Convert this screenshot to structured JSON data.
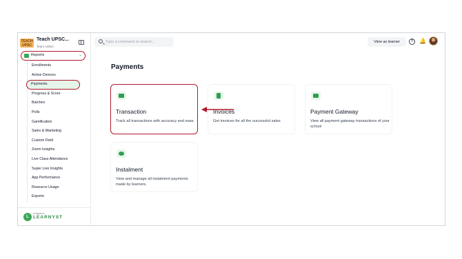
{
  "brand": {
    "name": "Teach UPSC...",
    "role": "Team Admin",
    "logo_text": "TEACH UPSC"
  },
  "sidebar": {
    "section_label": "Reports",
    "items": [
      {
        "label": "Enrollments"
      },
      {
        "label": "Active Devices"
      },
      {
        "label": "Payments",
        "active": true
      },
      {
        "label": "Progress & Score"
      },
      {
        "label": "Batches"
      },
      {
        "label": "Polls"
      },
      {
        "label": "Gamification"
      },
      {
        "label": "Sales & Marketing"
      },
      {
        "label": "Custom Field"
      },
      {
        "label": "Zoom Insights"
      },
      {
        "label": "Live Class Attendance"
      },
      {
        "label": "Super Live Insights"
      },
      {
        "label": "App Performance"
      },
      {
        "label": "Resource Usage"
      },
      {
        "label": "Exports"
      }
    ],
    "footer_powered": "POWERED BY",
    "footer_brand": "LEARNYST"
  },
  "topbar": {
    "search_placeholder": "Type a command or search...",
    "view_as_learner": "View as learner",
    "help_glyph": "?",
    "bell_glyph": "🔔"
  },
  "main": {
    "title": "Payments",
    "cards": [
      {
        "title": "Transaction",
        "desc": "Track all transactions with accuracy and ease.",
        "icon": "money-icon",
        "highlighted": true
      },
      {
        "title": "Invoices",
        "desc": "Get invoices for all the successful sales",
        "icon": "invoice-icon"
      },
      {
        "title": "Payment Gateway",
        "desc": "View all payment gateway transactions of your school",
        "icon": "card-icon"
      },
      {
        "title": "Instalment",
        "desc": "View and manage all instalment payments made by learners.",
        "icon": "instalment-icon"
      }
    ]
  },
  "colors": {
    "accent_green": "#2e9e4f",
    "highlight_red": "#b0182a",
    "active_bg": "#e6f4ea"
  }
}
